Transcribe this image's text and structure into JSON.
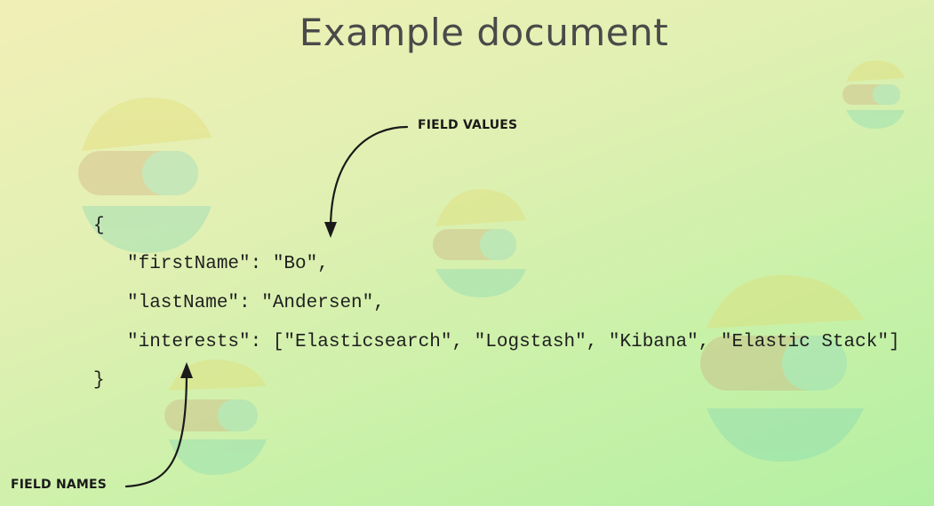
{
  "slide": {
    "title": "Example document"
  },
  "code": {
    "open_brace": "{",
    "fields": [
      {
        "line": "\"firstName\": \"Bo\","
      },
      {
        "line": "\"lastName\": \"Andersen\","
      },
      {
        "line": "\"interests\": [\"Elasticsearch\", \"Logstash\", \"Kibana\", \"Elastic Stack\"]"
      }
    ],
    "close_brace": "}"
  },
  "annotations": {
    "field_values": "FIELD VALUES",
    "field_names": "FIELD NAMES"
  },
  "colors": {
    "title": "#4a4a4a",
    "code_text": "#1f1f1f",
    "annotation": "#1a1a1a"
  }
}
